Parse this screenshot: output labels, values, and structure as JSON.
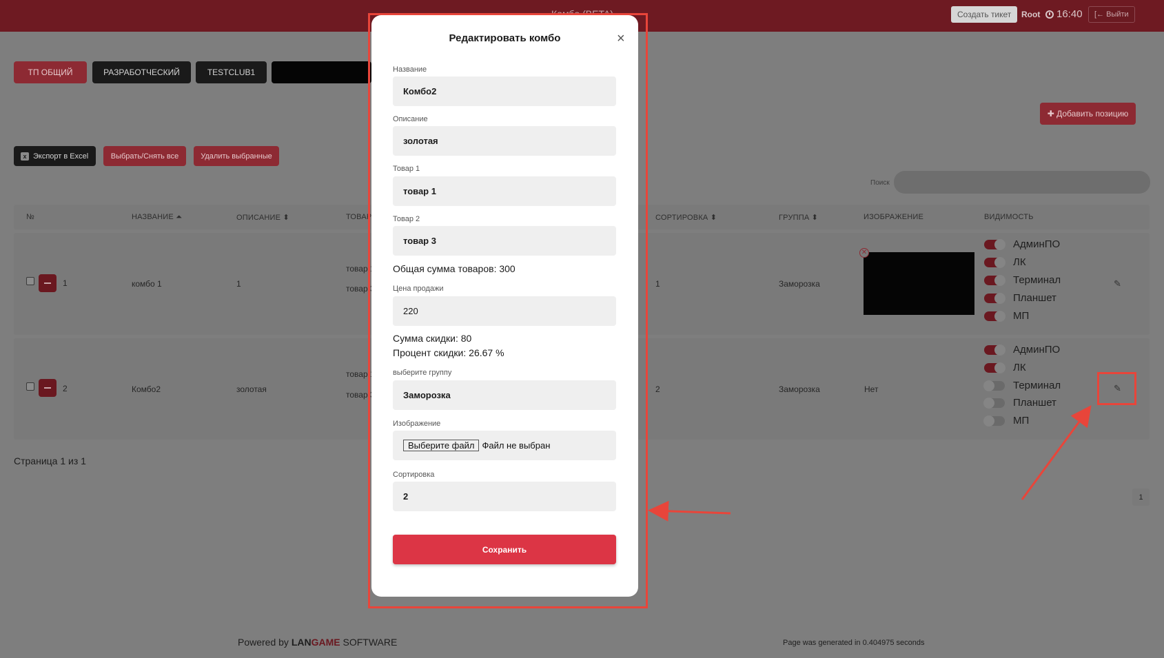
{
  "topbar": {
    "title": "Комбо (BETA)",
    "create_ticket": "Создать тикет",
    "user": "Root",
    "time": "16:40",
    "logout": "Выйти"
  },
  "clubs": [
    "ТП ОБЩИЙ",
    "РАЗРАБОТЧЕСКИЙ",
    "TESTCLUB1"
  ],
  "toolbar": {
    "add_position": "Добавить позицию",
    "export_excel": "Экспорт в Excel",
    "select_all": "Выбрать/Снять все",
    "delete_selected": "Удалить выбранные",
    "search_label": "Поиск"
  },
  "table": {
    "headers": {
      "num": "№",
      "name": "НАЗВАНИЕ",
      "description": "ОПИСАНИЕ",
      "goods": "ТОВАР",
      "sort": "СОРТИРОВКА",
      "group": "ГРУППА",
      "image": "ИЗОБРАЖЕНИЕ",
      "visibility": "ВИДИМОСТЬ"
    },
    "rows": [
      {
        "num": "1",
        "name": "комбо 1",
        "description": "1",
        "goods": [
          "товар 1",
          "товар 3"
        ],
        "sort": "1",
        "group": "Заморозка",
        "image": "",
        "visibility": [
          {
            "label": "АдминПО",
            "on": true
          },
          {
            "label": "ЛК",
            "on": true
          },
          {
            "label": "Терминал",
            "on": true
          },
          {
            "label": "Планшет",
            "on": true
          },
          {
            "label": "МП",
            "on": true
          }
        ]
      },
      {
        "num": "2",
        "name": "Комбо2",
        "description": "золотая",
        "goods": [
          "товар 1",
          "товар 3"
        ],
        "sort": "2",
        "group": "Заморозка",
        "image": "Нет",
        "visibility": [
          {
            "label": "АдминПО",
            "on": true
          },
          {
            "label": "ЛК",
            "on": true
          },
          {
            "label": "Терминал",
            "on": false
          },
          {
            "label": "Планшет",
            "on": false
          },
          {
            "label": "МП",
            "on": false
          }
        ]
      }
    ]
  },
  "pager": {
    "text": "Страница 1 из 1",
    "current": "1"
  },
  "footer": {
    "powered": "Powered by",
    "brand_a": "LAN",
    "brand_b": "GAME",
    "brand_c": "SOFTWARE",
    "generated": "Page was generated in 0.404975 seconds"
  },
  "modal": {
    "title": "Редактировать комбо",
    "name_label": "Название",
    "name_value": "Комбо2",
    "desc_label": "Описание",
    "desc_value": "золотая",
    "good1_label": "Товар 1",
    "good1_value": "товар 1",
    "good2_label": "Товар 2",
    "good2_value": "товар 3",
    "total_label": "Общая сумма товаров:",
    "total_value": "300",
    "price_label": "Цена продажи",
    "price_value": "220",
    "discount_label": "Сумма скидки:",
    "discount_value": "80",
    "percent_label": "Процент скидки:",
    "percent_value": "26.67 %",
    "group_label": "выберите группу",
    "group_value": "Заморозка",
    "image_label": "Изображение",
    "file_button": "Выберите файл",
    "file_status": "Файл не выбран",
    "sort_label": "Сортировка",
    "sort_value": "2",
    "save": "Сохранить"
  },
  "colors": {
    "accent": "#dc3545",
    "topbar": "#6e1a22",
    "annotation": "#e8453a"
  }
}
